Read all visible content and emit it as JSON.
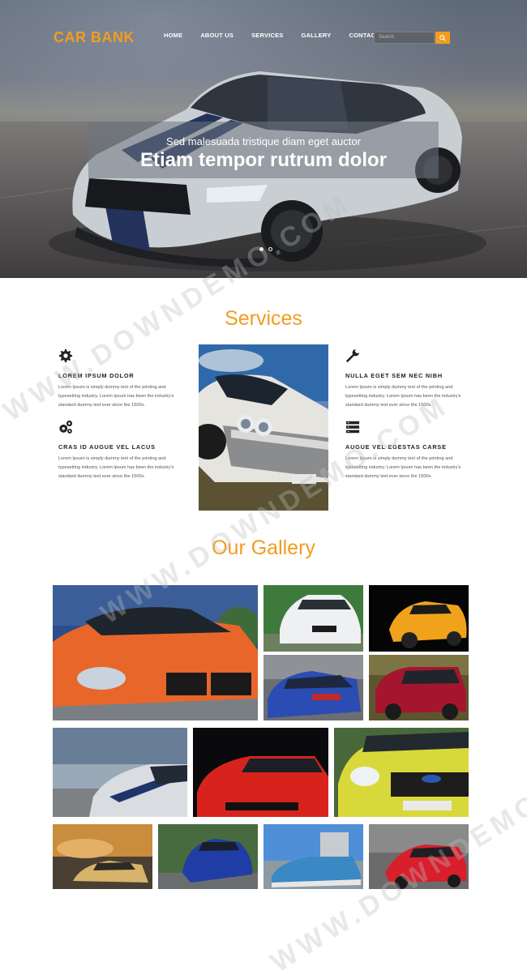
{
  "header": {
    "brand": "CAR BANK",
    "nav": [
      "HOME",
      "ABOUT US",
      "SERVICES",
      "GALLERY",
      "CONTACT"
    ],
    "search_placeholder": "Search",
    "accent": "#f39c1f"
  },
  "hero": {
    "subtitle": "Sed malesuada tristique diam eget auctor",
    "title": "Etiam tempor rutrum dolor",
    "slides": 2,
    "active_slide": 1
  },
  "services": {
    "heading": "Services",
    "items": [
      {
        "icon": "gear-icon",
        "title": "LOREM IPSUM DOLOR",
        "text": "Lorem Ipsum is simply dummy text of the printing and typesetting industry. Lorem Ipsum has been the industry's standard dummy text ever since the 1500s."
      },
      {
        "icon": "gears-icon",
        "title": "CRAS ID AUGUE VEL LACUS",
        "text": "Lorem Ipsum is simply dummy text of the printing and typesetting industry. Lorem Ipsum has been the industry's standard dummy text ever since the 1500s."
      },
      {
        "icon": "wrench-icon",
        "title": "NULLA EGET SEM NEC NIBH",
        "text": "Lorem Ipsum is simply dummy text of the printing and typesetting industry. Lorem Ipsum has been the industry's standard dummy text ever since the 1500s."
      },
      {
        "icon": "server-icon",
        "title": "AUGUE VEL EGESTAS CARSE",
        "text": "Lorem Ipsum is simply dummy text of the printing and typesetting industry. Lorem Ipsum has been the industry's standard dummy text ever since the 1500s."
      }
    ]
  },
  "gallery": {
    "heading": "Our Gallery",
    "photos": [
      "orange-car-photo",
      "white-car-photo",
      "yellow-car-photo",
      "blue-car-photo",
      "red-suv-photo",
      "white-blue-car-photo",
      "red-car-photo",
      "yellow-ford-photo",
      "gold-car-photo",
      "blue-jaguar-photo",
      "blue-classic-car-photo",
      "red-sports-car-photo"
    ]
  },
  "watermark": "WWW.DOWNDEMO.COM"
}
